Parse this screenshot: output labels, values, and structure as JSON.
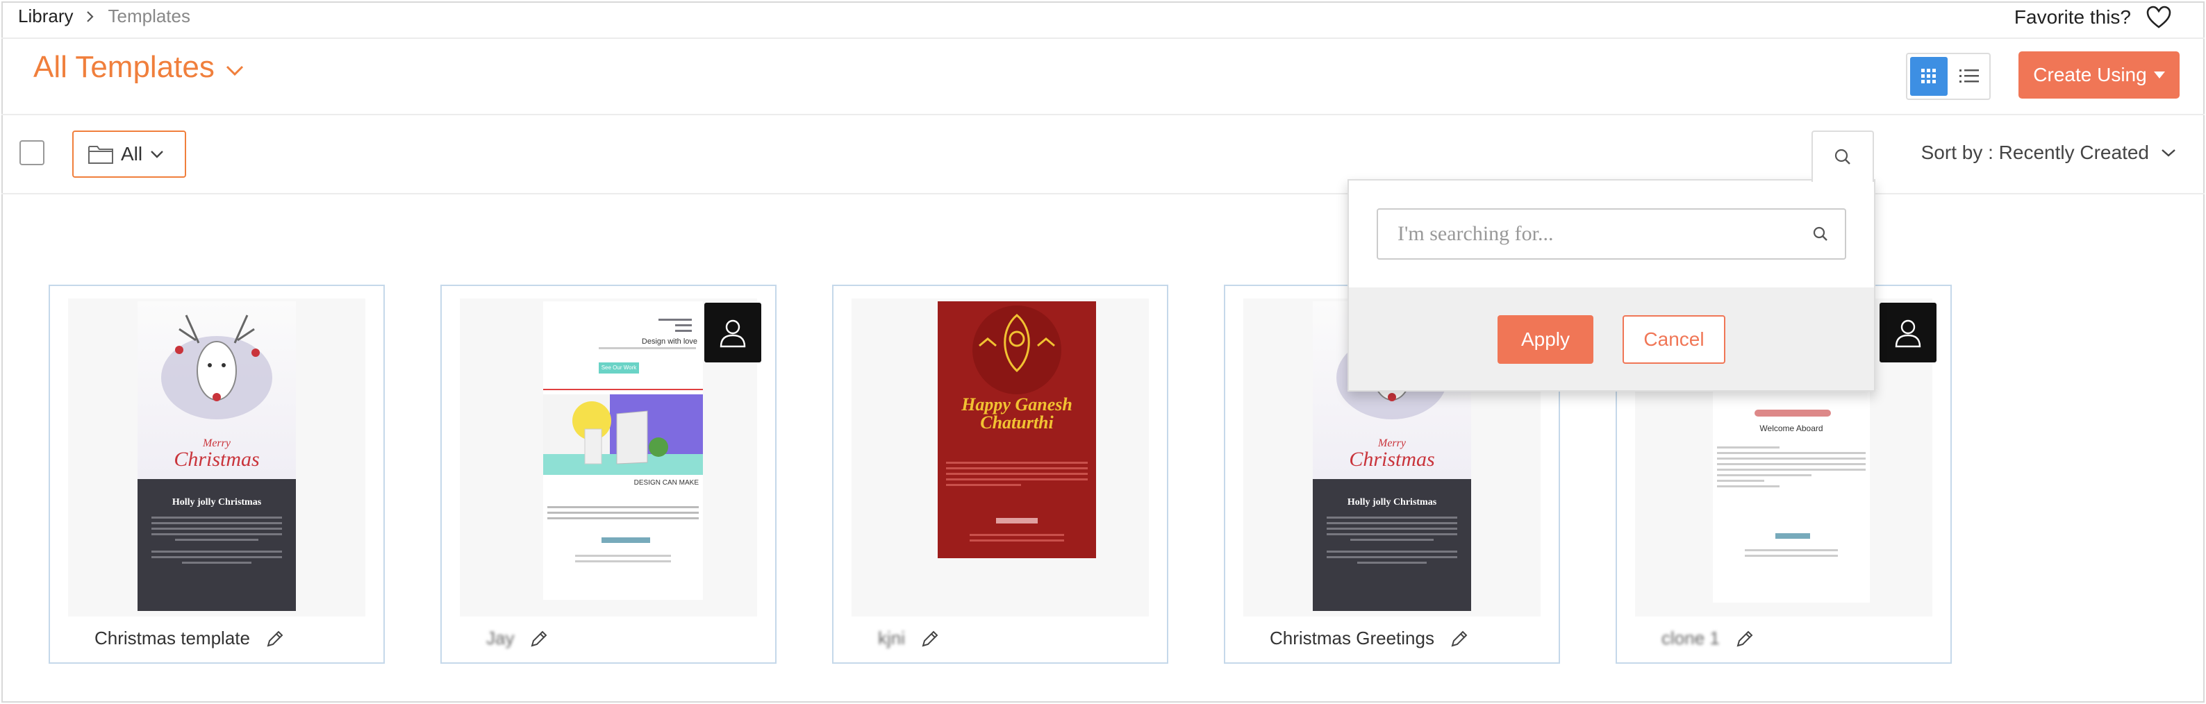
{
  "breadcrumb": {
    "items": [
      "Library",
      "Templates"
    ]
  },
  "favorite": {
    "label": "Favorite this?"
  },
  "header": {
    "title": "All Templates",
    "create_label": "Create Using"
  },
  "toolbar": {
    "folder_label": "All",
    "sort_label": "Sort by : Recently Created"
  },
  "search_popup": {
    "placeholder": "I'm searching for...",
    "apply_label": "Apply",
    "cancel_label": "Cancel"
  },
  "cards": [
    {
      "name": "Christmas template",
      "thumb": {
        "merry": "Merry",
        "christmas": "Christmas",
        "headline": "Holly jolly Christmas"
      }
    },
    {
      "name": "Jay",
      "thumb": {
        "heading": "Design with love",
        "button": "See Our Work",
        "section": "DESIGN CAN MAKE"
      }
    },
    {
      "name": "kjni",
      "thumb": {
        "happy": "Happy Ganesh",
        "chaturthi": "Chaturthi"
      }
    },
    {
      "name": "Christmas Greetings",
      "thumb": {
        "merry": "Merry",
        "christmas": "Christmas",
        "headline": "Holly jolly Christmas"
      }
    },
    {
      "name": "clone 1",
      "thumb": {
        "heading": "Welcome Aboard"
      }
    }
  ],
  "colors": {
    "accent": "#f07f3c",
    "button": "#f07656",
    "grid_active": "#3d8fe3",
    "card_border": "#c5d8ea"
  }
}
